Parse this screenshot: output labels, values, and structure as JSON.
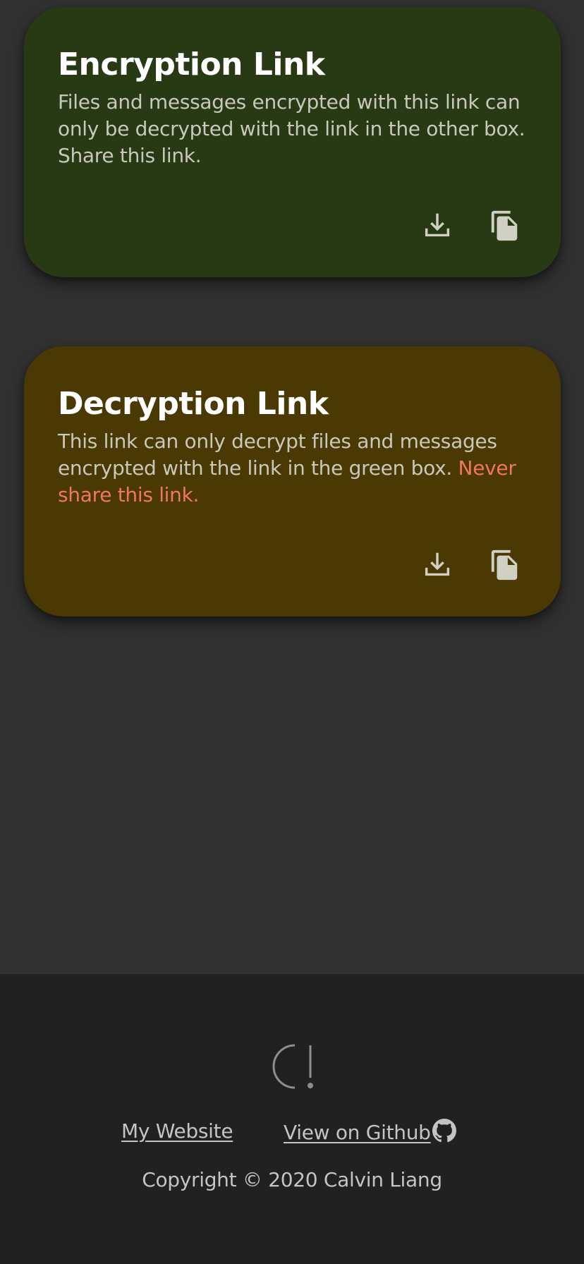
{
  "encryption_card": {
    "title": "Encryption Link",
    "description": "Files and messages encrypted with this link can only be decrypted with the link in the other box. Share this link.",
    "color": "#283a14",
    "actions": [
      {
        "icon": "download-icon"
      },
      {
        "icon": "copy-icon"
      }
    ]
  },
  "decryption_card": {
    "title": "Decryption Link",
    "description": "This link can only decrypt files and messages encrypted with the link in the green box. ",
    "warning": "Never share this link.",
    "color": "#4a3902",
    "warning_color": "#f0765e",
    "actions": [
      {
        "icon": "download-icon"
      },
      {
        "icon": "copy-icon"
      }
    ]
  },
  "footer": {
    "logo_icon": "logo-icon",
    "links": {
      "website": "My Website",
      "github": "View on Github "
    },
    "github_icon": "github-icon",
    "copyright": "Copyright © 2020 Calvin Liang"
  }
}
